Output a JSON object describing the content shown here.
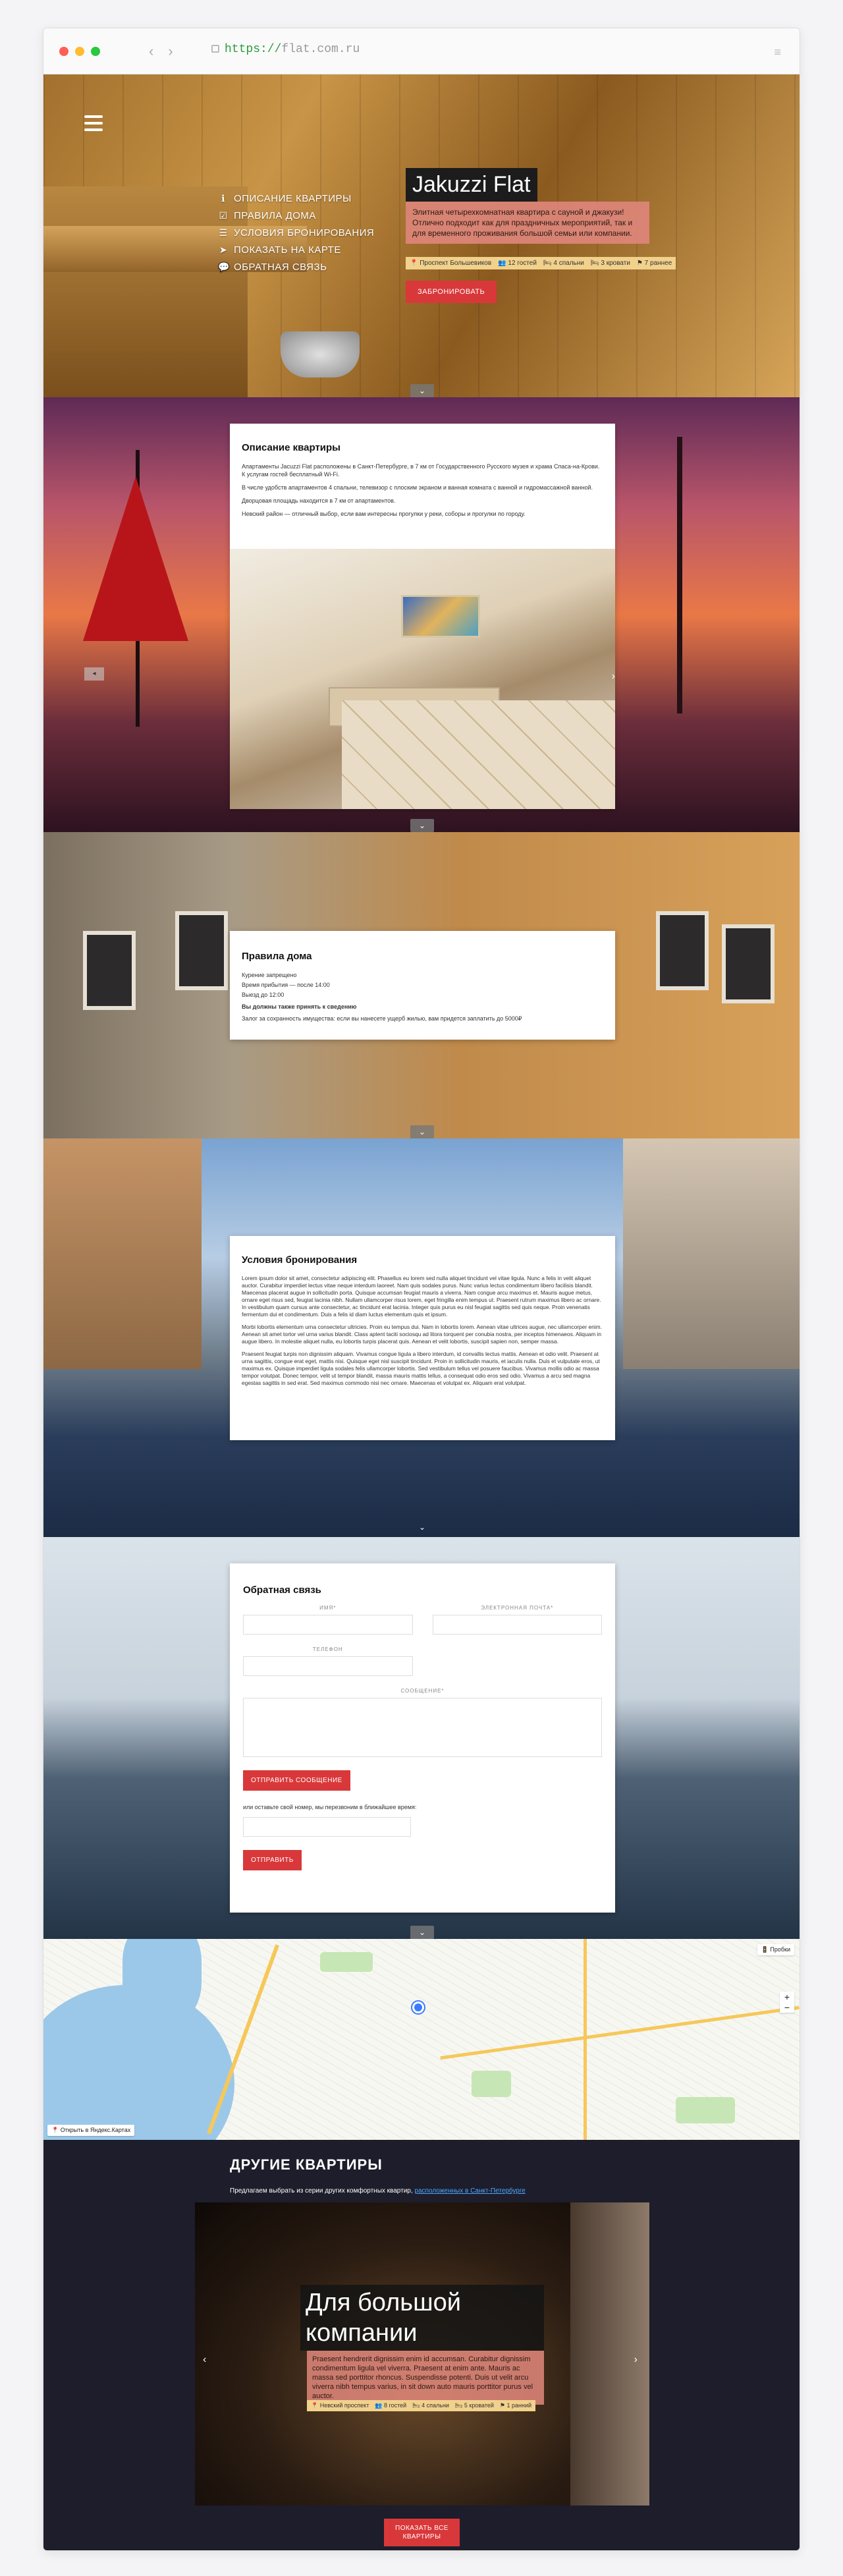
{
  "browser": {
    "url_scheme": "https://",
    "url_host": "flat.com.ru"
  },
  "hero": {
    "nav": [
      {
        "label": "ОПИСАНИЕ КВАРТИРЫ",
        "icon": "info-icon"
      },
      {
        "label": "ПРАВИЛА ДОМА",
        "icon": "checkbox-icon"
      },
      {
        "label": "УСЛОВИЯ БРОНИРОВАНИЯ",
        "icon": "list-icon"
      },
      {
        "label": "ПОКАЗАТЬ НА КАРТЕ",
        "icon": "location-arrow-icon"
      },
      {
        "label": "ОБРАТНАЯ СВЯЗЬ",
        "icon": "comments-icon"
      }
    ],
    "title": "Jakuzzi Flat",
    "description": "Элитная четырехкомнатная квартира с сауной и джакузи! Отлично подходит как для праздничных мероприятий, так и для временного проживания большой семьи или компании.",
    "features": [
      "Проспект Большевиков",
      "12 гостей",
      "4 спальни",
      "3 кровати",
      "7 раннее"
    ],
    "cta": "ЗАБРОНИРОВАТЬ"
  },
  "description": {
    "title": "Описание квартиры",
    "paragraphs": [
      "Апартаменты Jacuzzi Flat расположены в Санкт-Петербурге, в 7 км от Государственного Русского музея и храма Спаса-на-Крови. К услугам гостей бесплатный Wi-Fi.",
      "В числе удобств апартаментов 4 спальни, телевизор с плоским экраном и ванная комната с ванной и гидромассажной ванной.",
      "Дворцовая площадь находится в 7 км от апартаментов.",
      "Невский район — отличный выбор, если вам интересны прогулки у реки, соборы и прогулки по городу."
    ]
  },
  "rules": {
    "title": "Правила дома",
    "lines": [
      "Курение запрещено",
      "Время прибытия — после 14:00",
      "Выезд до 12:00"
    ],
    "bold": "Вы должны также принять к сведению",
    "note": "Залог за сохранность имущества: если вы нанесете ущерб жилью, вам придется заплатить до 5000₽"
  },
  "booking": {
    "title": "Условия бронирования",
    "paragraphs": [
      "Lorem ipsum dolor sit amet, consectetur adipiscing elit. Phasellus eu lorem sed nulla aliquet tincidunt vel vitae ligula. Nunc a felis in velit aliquet auctor. Curabitur imperdiet lectus vitae neque interdum laoreet. Nam quis sodales purus. Nunc varius lectus condimentum libero facilisis blandit. Maecenas placerat augue in sollicitudin porta. Quisque accumsan feugiat mauris a viverra. Nam congue arcu maximus et. Mauris augue metus, ornare eget risus sed, feugiat lacinia nibh. Nullam ullamcorper risus lorem, eget fringilla enim tempus ut. Praesent rutrum maximus libero ac ornare. In vestibulum quam cursus ante consectetur, ac tincidunt erat lacinia. Integer quis purus eu nisl feugiat sagittis sed quis neque. Proin venenatis fermentum dui et condimentum. Duis a felis id diam luctus elementum quis et ipsum.",
      "Morbi lobortis elementum urna consectetur ultricies. Proin eu tempus dui. Nam in lobortis lorem. Aenean vitae ultrices augue, nec ullamcorper enim. Aenean sit amet tortor vel urna varius blandit. Class aptent taciti sociosqu ad litora torquent per conubia nostra, per inceptos himenaeos. Aliquam in augue libero. In molestie aliquet nulla, eu lobortis turpis placerat quis. Aenean et velit lobortis, suscipit sapien non, semper massa.",
      "Praesent feugiat turpis non dignissim aliquam. Vivamus congue ligula a libero interdum, id convallis lectus mattis. Aenean et odio velit. Praesent at urna sagittis, congue erat eget, mattis nisi. Quisque eget nisl suscipit tincidunt. Proin in sollicitudin mauris, et iaculis nulla. Duis et vulputate eros, ut maximus ex. Quisque imperdiet ligula sodales felis ullamcorper lobortis. Sed vestibulum tellus vel posuere faucibus. Vivamus mollis odio ac massa tempor volutpat. Donec tempor, velit ut tempor blandit, massa mauris mattis tellus, a consequat odio eros sed odio. Vivamus a arcu sed magna egestas sagittis in sed erat. Sed maximus commodo nisi nec ornare. Maecenas et volutpat ex. Aliquam erat volutpat."
    ]
  },
  "contact": {
    "title": "Обратная связь",
    "name_label": "ИМЯ*",
    "email_label": "ЭЛЕКТРОННАЯ ПОЧТА*",
    "phone_label": "ТЕЛЕФОН",
    "message_label": "СООБЩЕНИЕ*",
    "submit": "ОТПРАВИТЬ СООБЩЕНИЕ",
    "callback_note": "или оставьте свой номер, мы перезвоним в ближайшее время:",
    "callback_submit": "ОТПРАВИТЬ"
  },
  "map": {
    "open_label": "Открыть в Яндекс.Картах",
    "traffic_label": "Пробки"
  },
  "other": {
    "title": "ДРУГИЕ КВАРТИРЫ",
    "intro": "Предлагаем выбрать из серии других комфортных квартир, ",
    "intro_link": "расположенных в Санкт-Петербурге",
    "card_title": "Для большой компании",
    "card_desc": "Praesent hendrerit dignissim enim id accumsan. Curabitur dignissim condimentum ligula vel viverra. Praesent at enim ante. Mauris ac massa sed porttitor rhoncus. Suspendisse potenti. Duis ut velit arcu viverra nibh tempus varius, in sit down auto mauris porttitor purus vel auctor.",
    "card_features": [
      "Невский проспект",
      "8 гостей",
      "4 спальни",
      "5 кроватей",
      "1 ранний"
    ],
    "show_all": "ПОКАЗАТЬ ВСЕ КВАРТИРЫ"
  }
}
